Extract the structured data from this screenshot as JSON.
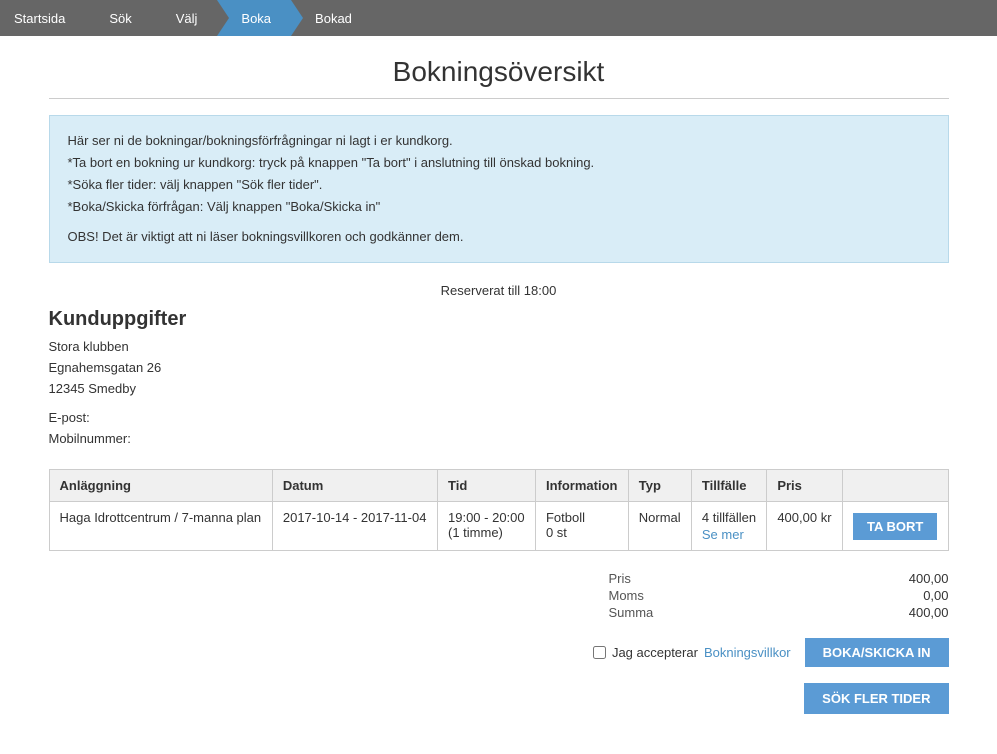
{
  "breadcrumb": {
    "items": [
      {
        "label": "Startsida",
        "active": false
      },
      {
        "label": "Sök",
        "active": false
      },
      {
        "label": "Välj",
        "active": false
      },
      {
        "label": "Boka",
        "active": true
      },
      {
        "label": "Bokad",
        "active": false
      }
    ]
  },
  "page": {
    "title": "Bokningsöversikt"
  },
  "info_box": {
    "line1": "Här ser ni de bokningar/bokningsförfrågningar ni lagt i er kundkorg.",
    "line2": "*Ta bort en bokning ur kundkorg: tryck på knappen \"Ta bort\" i anslutning till önskad bokning.",
    "line3": "*Söka fler tider: välj knappen \"Sök fler tider\".",
    "line4": "*Boka/Skicka förfrågan: Välj knappen \"Boka/Skicka in\"",
    "obs": "OBS! Det är viktigt att ni läser bokningsvillkoren och godkänner dem."
  },
  "reservation": {
    "label": "Reserverat till",
    "time": "18:00"
  },
  "customer": {
    "heading": "Kunduppgifter",
    "name": "Stora klubben",
    "address1": "Egnahemsgatan 26",
    "address2": "12345 Smedby",
    "email_label": "E-post:",
    "mobile_label": "Mobilnummer:"
  },
  "table": {
    "headers": [
      "Anläggning",
      "Datum",
      "Tid",
      "Information",
      "Typ",
      "Tillfälle",
      "Pris",
      ""
    ],
    "rows": [
      {
        "facility": "Haga Idrottcentrum / 7-manna plan",
        "date": "2017-10-14 - 2017-11-04",
        "time": "19:00 - 20:00",
        "time_sub": "(1 timme)",
        "information": "Fotboll",
        "info_sub": "0 st",
        "type": "Normal",
        "occasions": "4 tillfällen",
        "see_more": "Se mer",
        "price": "400,00 kr",
        "action": "TA BORT"
      }
    ]
  },
  "summary": {
    "pris_label": "Pris",
    "pris_value": "400,00",
    "moms_label": "Moms",
    "moms_value": "0,00",
    "summa_label": "Summa",
    "summa_value": "400,00"
  },
  "terms": {
    "checkbox_label": "Jag accepterar",
    "link_label": "Bokningsvillkor"
  },
  "buttons": {
    "boka": "BOKA/SKICKA IN",
    "sok_fler": "SÖK FLER TIDER",
    "ta_bort": "TA BORT"
  }
}
